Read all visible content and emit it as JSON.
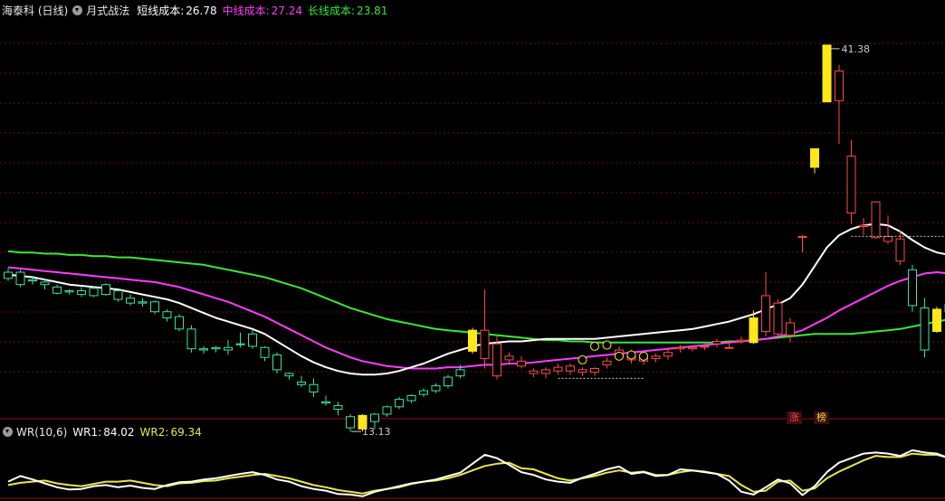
{
  "header": {
    "stock": "海泰科 (日线)",
    "indicator": "月式战法",
    "short": {
      "label": "短线成本:",
      "value": "26.78",
      "color": "#ffffff"
    },
    "mid": {
      "label": "中线成本:",
      "value": "27.24",
      "color": "#ff3cff"
    },
    "long": {
      "label": "长线成本:",
      "value": "23.81",
      "color": "#38e838"
    }
  },
  "sub_header": {
    "name": "WR(10,6)",
    "wr1": {
      "label": "WR1:",
      "value": "84.02",
      "color": "#ffffff"
    },
    "wr2": {
      "label": "WR2:",
      "value": "69.34",
      "color": "#e8e84a"
    }
  },
  "annotations": {
    "high": "41.38",
    "low": "13.13",
    "tag1": "涨",
    "tag2": "榜"
  },
  "colors": {
    "up": "#ff4a4a",
    "down": "#38e2a8",
    "special": "#ffe81a",
    "grid": "#6a0f0f",
    "white_line": "#ffffff",
    "magenta_line": "#ff3cff",
    "green_line": "#38e838"
  },
  "chart_data": {
    "type": "candlestick",
    "price_range": [
      11.5,
      43.0
    ],
    "wr_range": [
      0,
      100
    ],
    "candles": [
      {
        "o": 23.0,
        "h": 23.3,
        "l": 22.3,
        "c": 22.5,
        "t": "down"
      },
      {
        "o": 23.0,
        "h": 23.2,
        "l": 21.8,
        "c": 22.0,
        "t": "down"
      },
      {
        "o": 22.4,
        "h": 22.6,
        "l": 22.0,
        "c": 22.3,
        "t": "down"
      },
      {
        "o": 22.2,
        "h": 22.5,
        "l": 21.6,
        "c": 22.0,
        "t": "down"
      },
      {
        "o": 21.8,
        "h": 22.0,
        "l": 21.2,
        "c": 21.3,
        "t": "down"
      },
      {
        "o": 21.5,
        "h": 21.6,
        "l": 21.2,
        "c": 21.4,
        "t": "down"
      },
      {
        "o": 21.5,
        "h": 21.8,
        "l": 21.0,
        "c": 21.2,
        "t": "down"
      },
      {
        "o": 21.7,
        "h": 21.9,
        "l": 21.0,
        "c": 21.1,
        "t": "down"
      },
      {
        "o": 22.0,
        "h": 22.1,
        "l": 21.1,
        "c": 21.2,
        "t": "down"
      },
      {
        "o": 21.5,
        "h": 21.6,
        "l": 20.6,
        "c": 20.8,
        "t": "down"
      },
      {
        "o": 20.9,
        "h": 21.2,
        "l": 20.3,
        "c": 20.5,
        "t": "down"
      },
      {
        "o": 20.6,
        "h": 20.9,
        "l": 20.2,
        "c": 20.5,
        "t": "down"
      },
      {
        "o": 20.6,
        "h": 20.7,
        "l": 19.6,
        "c": 19.8,
        "t": "down"
      },
      {
        "o": 19.8,
        "h": 20.0,
        "l": 19.0,
        "c": 19.3,
        "t": "down"
      },
      {
        "o": 19.4,
        "h": 19.6,
        "l": 18.2,
        "c": 18.4,
        "t": "down"
      },
      {
        "o": 18.4,
        "h": 18.7,
        "l": 16.5,
        "c": 16.8,
        "t": "down"
      },
      {
        "o": 16.8,
        "h": 17.0,
        "l": 16.4,
        "c": 16.7,
        "t": "down"
      },
      {
        "o": 16.8,
        "h": 17.0,
        "l": 16.5,
        "c": 16.9,
        "t": "down"
      },
      {
        "o": 16.9,
        "h": 17.5,
        "l": 16.3,
        "c": 16.7,
        "t": "down"
      },
      {
        "o": 17.2,
        "h": 18.1,
        "l": 16.9,
        "c": 17.2,
        "t": "down"
      },
      {
        "o": 18.0,
        "h": 18.3,
        "l": 16.8,
        "c": 17.0,
        "t": "down"
      },
      {
        "o": 16.9,
        "h": 17.0,
        "l": 15.8,
        "c": 16.1,
        "t": "down"
      },
      {
        "o": 16.3,
        "h": 16.5,
        "l": 14.8,
        "c": 15.1,
        "t": "down"
      },
      {
        "o": 14.8,
        "h": 14.9,
        "l": 14.3,
        "c": 14.6,
        "t": "down"
      },
      {
        "o": 14.1,
        "h": 14.6,
        "l": 13.7,
        "c": 13.9,
        "t": "down"
      },
      {
        "o": 13.9,
        "h": 14.4,
        "l": 12.9,
        "c": 13.3,
        "t": "down"
      },
      {
        "o": 12.4,
        "h": 13.0,
        "l": 12.2,
        "c": 12.5,
        "t": "down"
      },
      {
        "o": 11.9,
        "h": 12.5,
        "l": 11.4,
        "c": 12.2,
        "t": "down"
      },
      {
        "o": 11.3,
        "h": 11.5,
        "l": 10.1,
        "c": 10.4,
        "t": "down"
      },
      {
        "o": 10.3,
        "h": 11.5,
        "l": 10.1,
        "c": 11.4,
        "t": "special"
      },
      {
        "o": 10.9,
        "h": 11.6,
        "l": 10.3,
        "c": 11.5,
        "t": "down"
      },
      {
        "o": 11.5,
        "h": 12.2,
        "l": 11.3,
        "c": 12.1,
        "t": "down"
      },
      {
        "o": 12.1,
        "h": 12.9,
        "l": 11.9,
        "c": 12.7,
        "t": "down"
      },
      {
        "o": 12.6,
        "h": 13.1,
        "l": 12.4,
        "c": 13.0,
        "t": "down"
      },
      {
        "o": 13.1,
        "h": 13.6,
        "l": 12.9,
        "c": 13.4,
        "t": "down"
      },
      {
        "o": 13.4,
        "h": 14.0,
        "l": 13.2,
        "c": 13.8,
        "t": "down"
      },
      {
        "o": 13.8,
        "h": 14.7,
        "l": 13.6,
        "c": 14.5,
        "t": "down"
      },
      {
        "o": 14.6,
        "h": 15.5,
        "l": 14.4,
        "c": 15.1,
        "t": "down"
      },
      {
        "o": 16.6,
        "h": 18.5,
        "l": 16.4,
        "c": 18.3,
        "t": "special"
      },
      {
        "o": 18.3,
        "h": 21.6,
        "l": 15.2,
        "c": 16.0,
        "t": "up"
      },
      {
        "o": 17.2,
        "h": 17.8,
        "l": 14.3,
        "c": 14.6,
        "t": "up"
      },
      {
        "o": 15.9,
        "h": 16.5,
        "l": 15.5,
        "c": 16.2,
        "t": "up"
      },
      {
        "o": 15.4,
        "h": 16.2,
        "l": 15.2,
        "c": 15.8,
        "t": "up"
      },
      {
        "o": 14.8,
        "h": 15.2,
        "l": 14.5,
        "c": 15.0,
        "t": "up"
      },
      {
        "o": 14.8,
        "h": 15.3,
        "l": 14.4,
        "c": 15.1,
        "t": "up"
      },
      {
        "o": 15.0,
        "h": 15.6,
        "l": 14.7,
        "c": 15.3,
        "t": "up"
      },
      {
        "o": 15.0,
        "h": 15.6,
        "l": 14.7,
        "c": 15.4,
        "t": "up"
      },
      {
        "o": 14.9,
        "h": 15.3,
        "l": 14.6,
        "c": 15.1,
        "t": "up"
      },
      {
        "o": 14.9,
        "h": 15.3,
        "l": 14.6,
        "c": 15.2,
        "t": "up"
      },
      {
        "o": 15.5,
        "h": 16.1,
        "l": 15.2,
        "c": 15.8,
        "t": "up"
      },
      {
        "o": 16.2,
        "h": 17.0,
        "l": 15.9,
        "c": 16.7,
        "t": "up"
      },
      {
        "o": 15.9,
        "h": 16.7,
        "l": 15.6,
        "c": 16.3,
        "t": "up"
      },
      {
        "o": 15.8,
        "h": 16.3,
        "l": 15.5,
        "c": 16.1,
        "t": "up"
      },
      {
        "o": 16.0,
        "h": 16.4,
        "l": 15.7,
        "c": 16.2,
        "t": "up"
      },
      {
        "o": 16.2,
        "h": 16.9,
        "l": 15.9,
        "c": 16.5,
        "t": "up"
      },
      {
        "o": 16.8,
        "h": 17.1,
        "l": 16.5,
        "c": 16.9,
        "t": "up"
      },
      {
        "o": 16.8,
        "h": 17.0,
        "l": 16.6,
        "c": 16.9,
        "t": "up"
      },
      {
        "o": 17.0,
        "h": 17.2,
        "l": 16.7,
        "c": 17.0,
        "t": "up"
      },
      {
        "o": 17.2,
        "h": 17.6,
        "l": 16.9,
        "c": 17.4,
        "t": "up"
      },
      {
        "o": 16.9,
        "h": 17.3,
        "l": 16.8,
        "c": 16.9,
        "t": "up"
      },
      {
        "o": 17.5,
        "h": 17.8,
        "l": 17.2,
        "c": 17.4,
        "t": "up"
      },
      {
        "o": 17.3,
        "h": 19.9,
        "l": 17.2,
        "c": 19.3,
        "t": "special"
      },
      {
        "o": 18.2,
        "h": 23.0,
        "l": 17.8,
        "c": 21.1,
        "t": "up"
      },
      {
        "o": 20.5,
        "h": 20.8,
        "l": 17.8,
        "c": 18.0,
        "t": "up"
      },
      {
        "o": 17.9,
        "h": 19.3,
        "l": 17.3,
        "c": 18.9,
        "t": "up"
      },
      {
        "o": 25.9,
        "h": 26.0,
        "l": 24.6,
        "c": 25.9,
        "t": "up"
      },
      {
        "o": 31.5,
        "h": 33.0,
        "l": 31.0,
        "c": 33.0,
        "t": "special"
      },
      {
        "o": 36.8,
        "h": 41.4,
        "l": 36.8,
        "c": 41.4,
        "t": "special"
      },
      {
        "o": 39.3,
        "h": 39.8,
        "l": 33.4,
        "c": 36.9,
        "t": "up"
      },
      {
        "o": 32.4,
        "h": 33.7,
        "l": 26.9,
        "c": 27.8,
        "t": "up"
      },
      {
        "o": 26.7,
        "h": 27.4,
        "l": 26.0,
        "c": 26.8,
        "t": "up"
      },
      {
        "o": 28.7,
        "h": 28.7,
        "l": 25.7,
        "c": 25.8,
        "t": "up"
      },
      {
        "o": 25.5,
        "h": 27.6,
        "l": 25.3,
        "c": 25.9,
        "t": "up"
      },
      {
        "o": 25.7,
        "h": 26.4,
        "l": 23.6,
        "c": 23.9,
        "t": "up"
      },
      {
        "o": 23.2,
        "h": 23.6,
        "l": 19.8,
        "c": 20.3,
        "t": "down"
      },
      {
        "o": 20.1,
        "h": 20.9,
        "l": 16.1,
        "c": 16.7,
        "t": "down"
      },
      {
        "o": 18.2,
        "h": 20.2,
        "l": 18.1,
        "c": 20.0,
        "t": "special"
      },
      {
        "o": 19.8,
        "h": 20.7,
        "l": 19.4,
        "c": 20.4,
        "t": "down"
      }
    ],
    "short_cost": [
      22.8,
      22.7,
      22.6,
      22.4,
      22.2,
      22.0,
      21.9,
      21.8,
      21.7,
      21.6,
      21.4,
      21.2,
      21.0,
      20.8,
      20.5,
      20.1,
      19.7,
      19.3,
      19.0,
      18.7,
      18.4,
      18.0,
      17.4,
      16.8,
      16.2,
      15.7,
      15.3,
      15.0,
      14.8,
      14.7,
      14.7,
      14.8,
      15.0,
      15.3,
      15.6,
      16.0,
      16.4,
      16.7,
      17.0,
      17.2,
      17.3,
      17.4,
      17.4,
      17.5,
      17.6,
      17.6,
      17.6,
      17.6,
      17.6,
      17.7,
      17.8,
      17.9,
      18.0,
      18.1,
      18.2,
      18.3,
      18.4,
      18.6,
      18.8,
      19.0,
      19.3,
      19.6,
      20.0,
      20.4,
      20.9,
      22.0,
      23.5,
      25.0,
      26.0,
      26.5,
      26.8,
      26.9,
      26.8,
      26.3,
      25.6,
      25.0,
      24.6,
      24.4
    ],
    "mid_cost": [
      23.4,
      23.3,
      23.2,
      23.1,
      23.0,
      22.9,
      22.8,
      22.7,
      22.6,
      22.5,
      22.4,
      22.3,
      22.2,
      22.0,
      21.8,
      21.5,
      21.2,
      20.9,
      20.6,
      20.2,
      19.8,
      19.4,
      18.9,
      18.4,
      17.9,
      17.4,
      16.9,
      16.5,
      16.1,
      15.8,
      15.6,
      15.4,
      15.3,
      15.2,
      15.2,
      15.2,
      15.3,
      15.3,
      15.4,
      15.5,
      15.5,
      15.6,
      15.6,
      15.7,
      15.8,
      15.9,
      16.0,
      16.1,
      16.2,
      16.3,
      16.4,
      16.5,
      16.6,
      16.7,
      16.8,
      16.9,
      17.0,
      17.1,
      17.2,
      17.3,
      17.4,
      17.5,
      17.6,
      17.8,
      18.0,
      18.3,
      18.8,
      19.3,
      19.9,
      20.4,
      20.9,
      21.4,
      21.9,
      22.3,
      22.6,
      22.9,
      23.0,
      22.9
    ],
    "long_cost": [
      24.7,
      24.6,
      24.6,
      24.5,
      24.5,
      24.4,
      24.4,
      24.3,
      24.3,
      24.2,
      24.2,
      24.1,
      24.0,
      23.9,
      23.8,
      23.7,
      23.6,
      23.4,
      23.2,
      23.0,
      22.8,
      22.6,
      22.3,
      22.0,
      21.7,
      21.3,
      20.9,
      20.5,
      20.1,
      19.8,
      19.5,
      19.2,
      19.0,
      18.8,
      18.6,
      18.4,
      18.3,
      18.2,
      18.1,
      18.0,
      17.9,
      17.8,
      17.7,
      17.6,
      17.5,
      17.5,
      17.4,
      17.4,
      17.3,
      17.3,
      17.3,
      17.3,
      17.3,
      17.3,
      17.3,
      17.3,
      17.3,
      17.3,
      17.3,
      17.4,
      17.4,
      17.5,
      17.6,
      17.7,
      17.8,
      17.9,
      18.0,
      18.0,
      18.0,
      18.0,
      18.1,
      18.2,
      18.3,
      18.4,
      18.6,
      18.8,
      19.0,
      19.2
    ],
    "wr1": [
      72,
      62,
      68,
      75,
      82,
      86,
      85,
      80,
      78,
      82,
      79,
      83,
      85,
      78,
      73,
      72,
      68,
      66,
      62,
      58,
      55,
      60,
      68,
      72,
      80,
      85,
      88,
      94,
      95,
      98,
      90,
      85,
      80,
      75,
      72,
      68,
      62,
      56,
      40,
      24,
      30,
      42,
      55,
      60,
      68,
      72,
      74,
      65,
      58,
      50,
      45,
      58,
      55,
      62,
      60,
      50,
      52,
      55,
      58,
      70,
      90,
      95,
      82,
      68,
      75,
      96,
      80,
      55,
      38,
      30,
      22,
      20,
      22,
      26,
      16,
      20,
      22,
      30
    ],
    "wr2": [
      78,
      74,
      72,
      70,
      75,
      78,
      80,
      76,
      72,
      72,
      70,
      74,
      78,
      80,
      75,
      74,
      71,
      70,
      66,
      63,
      60,
      58,
      62,
      66,
      72,
      78,
      82,
      87,
      90,
      93,
      88,
      85,
      82,
      76,
      72,
      70,
      66,
      60,
      52,
      44,
      40,
      38,
      48,
      50,
      58,
      66,
      70,
      66,
      62,
      56,
      52,
      56,
      54,
      60,
      60,
      55,
      52,
      54,
      58,
      62,
      78,
      90,
      88,
      72,
      70,
      88,
      84,
      66,
      54,
      44,
      34,
      26,
      28,
      28,
      22,
      24,
      24,
      30
    ]
  }
}
